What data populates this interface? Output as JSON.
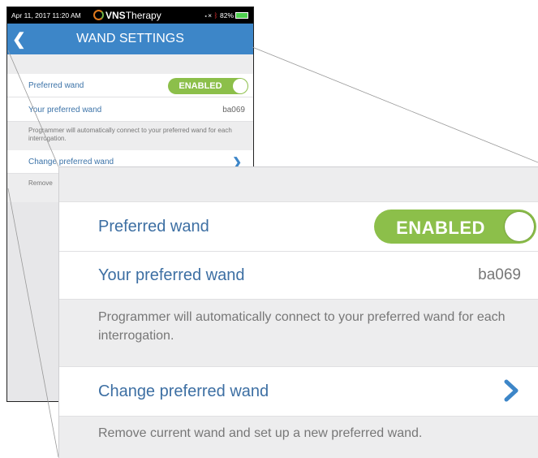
{
  "status_bar": {
    "date_time": "Apr 11, 2017  11:20 AM",
    "brand_bold": "VNS",
    "brand_light": "Therapy",
    "battery": "82%"
  },
  "nav": {
    "back_icon": "chevron-left-icon",
    "title": "WAND SETTINGS"
  },
  "settings": {
    "preferred_wand_label": "Preferred wand",
    "toggle_state": "ENABLED",
    "your_wand_label": "Your preferred wand",
    "your_wand_value": "ba069",
    "note": "Programmer will automatically connect to your preferred wand for each interrogation.",
    "change_label": "Change preferred wand",
    "change_icon": "chevron-right-icon",
    "remove_note": "Remove current wand and set up a new preferred wand.",
    "remove_note_truncated": "Remove"
  },
  "colors": {
    "nav_blue": "#3d86c8",
    "toggle_green": "#8cbf4a",
    "label_blue": "#3d6fa3"
  }
}
